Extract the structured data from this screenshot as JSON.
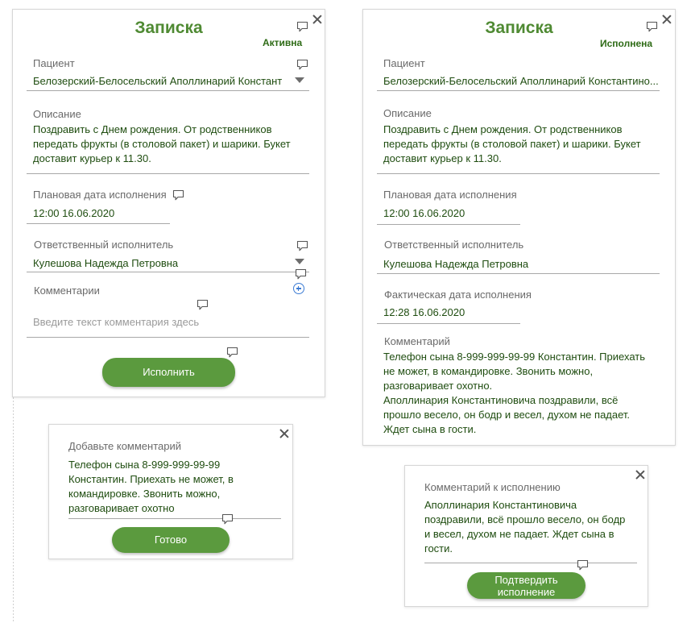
{
  "left_card": {
    "title": "Записка",
    "status": "Активна",
    "patient_label": "Пациент",
    "patient_value": "Белозерский-Белосельский Аполлинарий Констант",
    "description_label": "Описание",
    "description_lines": [
      "Поздравить с Днем рождения. От родственников",
      "передать фрукты (в столовой пакет) и шарики. Букет",
      "доставит курьер к 11.30."
    ],
    "planned_label": "Плановая дата исполнения",
    "planned_value": "12:00 16.06.2020",
    "responsible_label": "Ответственный исполнитель",
    "responsible_value": "Кулешова Надежда Петровна",
    "comments_label": "Комментарии",
    "comment_placeholder": "Введите текст комментария здесь",
    "execute_button": "Исполнить"
  },
  "right_card": {
    "title": "Записка",
    "status": "Исполнена",
    "patient_label": "Пациент",
    "patient_value": "Белозерский-Белосельский Аполлинарий Константино...",
    "description_label": "Описание",
    "description_lines": [
      "Поздравить с Днем рождения. От родственников",
      "передать фрукты (в столовой пакет) и шарики. Букет",
      "доставит курьер к 11.30."
    ],
    "planned_label": "Плановая дата исполнения",
    "planned_value": "12:00 16.06.2020",
    "responsible_label": "Ответственный исполнитель",
    "responsible_value": "Кулешова Надежда Петровна",
    "actual_label": "Фактическая дата исполнения",
    "actual_value": "12:28 16.06.2020",
    "comment_label": "Комментарий",
    "comment_lines": [
      "Телефон сына 8-999-999-99-99 Константин. Приехать",
      "не может, в командировке. Звонить можно,",
      "разговаривает охотно.",
      "Аполлинария Константиновича поздравили, всё",
      "прошло весело, он бодр и весел, духом не падает.",
      "Ждет сына в гости."
    ]
  },
  "add_comment_dialog": {
    "title": "Добавьте комментарий",
    "text_lines": [
      "Телефон сына 8-999-999-99-99",
      "Константин. Приехать не может, в",
      "командировке. Звонить можно,",
      "разговаривает охотно"
    ],
    "done_button": "Готово"
  },
  "execution_comment_dialog": {
    "title": "Комментарий к исполнению",
    "text_lines": [
      "Аполлинария Константиновича",
      "поздравили, всё прошло весело, он бодр",
      "и весел, духом не падает. Ждет сына в",
      "гости."
    ],
    "confirm_button_lines": [
      "Подтвердить",
      "исполнение"
    ]
  },
  "colors": {
    "accent": "#5b9a3e",
    "title": "#4f8a33",
    "text": "#1f4d10",
    "label": "#6a6a6a",
    "add_icon": "#3b7bd4"
  },
  "icons": [
    "close-icon",
    "comment-bubble-icon",
    "dropdown-caret-icon",
    "add-circle-icon"
  ]
}
